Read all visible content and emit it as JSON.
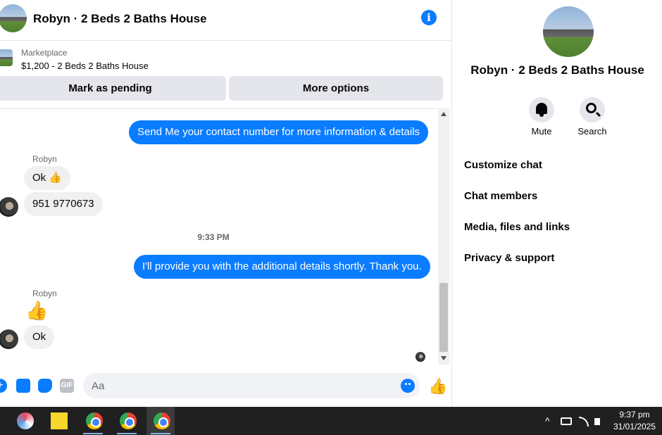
{
  "header": {
    "title": "Robyn · 2 Beds 2 Baths House",
    "info_icon_glyph": "i"
  },
  "marketplace": {
    "label": "Marketplace",
    "item": "$1,200 - 2 Beds 2 Baths House",
    "pending_button": "Mark as pending",
    "more_button": "More options"
  },
  "messages": [
    {
      "from": "me",
      "text": "Send Me your contact number for more information & details"
    },
    {
      "from": "Robyn",
      "sender_label": "Robyn",
      "text": "Ok 👍"
    },
    {
      "from": "Robyn",
      "text": "951 9770673"
    },
    {
      "timestamp": "9:33 PM"
    },
    {
      "from": "me",
      "text": "I'll provide you with the additional details shortly. Thank you."
    },
    {
      "from": "Robyn",
      "sender_label": "Robyn",
      "text": "👍"
    },
    {
      "from": "Robyn",
      "text": "Ok"
    }
  ],
  "composer": {
    "placeholder": "Aa",
    "gif_label": "GIF",
    "plus_glyph": "+",
    "like_glyph": "👍"
  },
  "info_panel": {
    "title": "Robyn · 2 Beds 2 Baths House",
    "actions": [
      {
        "label": "Mute",
        "icon": "bell-icon"
      },
      {
        "label": "Search",
        "icon": "search-icon"
      }
    ],
    "menu": [
      "Customize chat",
      "Chat members",
      "Media, files and links",
      "Privacy & support"
    ]
  },
  "taskbar": {
    "time": "9:37 pm",
    "date": "31/01/2025",
    "tray_chevron": "^"
  },
  "colors": {
    "accent": "#0a7cff",
    "incoming_bubble": "#f0f0f0",
    "taskbar": "#202020"
  }
}
